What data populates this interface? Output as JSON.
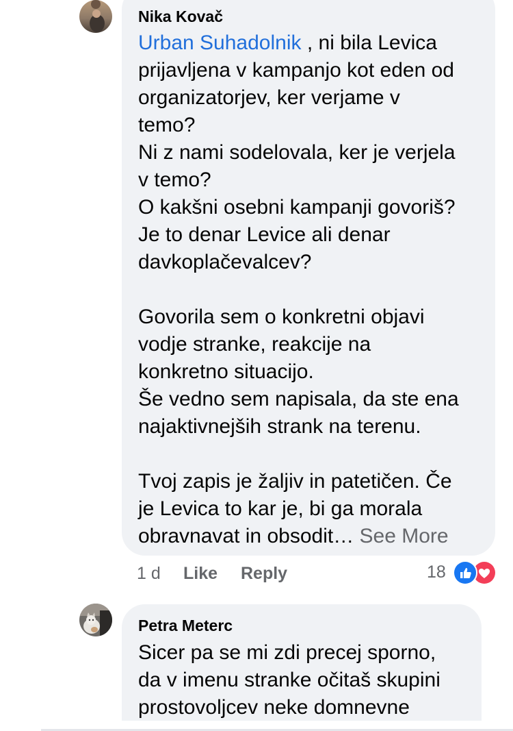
{
  "comments": [
    {
      "author": "Nika Kovač",
      "mention": "Urban Suhadolnik",
      "text": " , ni bila Levica\nprijavljena v kampanjo kot eden od\norganizatorjev, ker verjame v\ntemo?\nNi z nami sodelovala, ker je verjela\nv temo?\nO kakšni osebni kampanji govoriš?\nJe to denar Levice ali denar\ndavkoplačevalcev?\n\nGovorila sem o konkretni objavi\nvodje stranke, reakcije na\nkonkretno situacijo.\nŠe vedno sem napisala, da ste ena\nnajaktivnejših strank na terenu.\n\nTvoj zapis je žaljiv in patetičen. Če\nje Levica to kar je, bi ga morala\nobravnavat in obsodit…",
      "see_more": "See More",
      "time": "1 d",
      "like_label": "Like",
      "reply_label": "Reply",
      "reaction_count": "18",
      "reactions": [
        "like-icon",
        "love-icon"
      ]
    },
    {
      "author": "Petra Meterc",
      "text": "Sicer pa se mi zdi precej sporno,\nda v imenu stranke očitaš skupini\nprostovoljcev neke domnevne"
    }
  ],
  "colors": {
    "bubble": "#f0f2f5",
    "mention": "#216fdb",
    "secondary_text": "#65676b",
    "like_blue": "#1877f2",
    "love_red": "#f33e58"
  }
}
